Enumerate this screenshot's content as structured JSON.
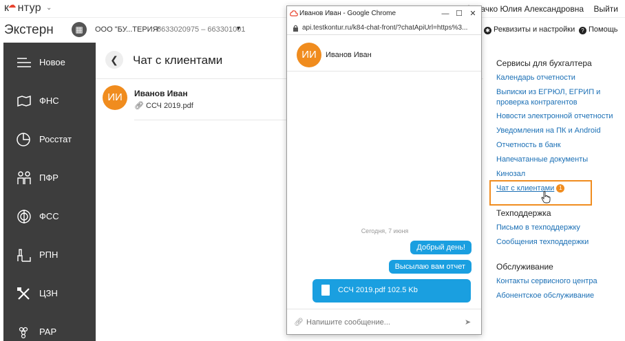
{
  "topbar": {
    "logo": "кнтур",
    "user_name": "Сачко Юлия Александровна",
    "logout": "Выйти"
  },
  "header": {
    "product": "Экстерн",
    "org_name": "ООО \"БУ...ТЕРИЯ\"",
    "org_inn": "6633020975 – 663301001",
    "settings": "Реквизиты и настройки",
    "help": "Помощь"
  },
  "sidebar": {
    "items": [
      {
        "label": "Новое",
        "icon": "list-icon"
      },
      {
        "label": "ФНС",
        "icon": "map-icon"
      },
      {
        "label": "Росстат",
        "icon": "pie-chart-icon"
      },
      {
        "label": "ПФР",
        "icon": "people-icon"
      },
      {
        "label": "ФСС",
        "icon": "fss-icon"
      },
      {
        "label": "РПН",
        "icon": "factory-icon"
      },
      {
        "label": "ЦЗН",
        "icon": "tools-icon"
      },
      {
        "label": "РАР",
        "icon": "grapes-icon"
      }
    ]
  },
  "main": {
    "title": "Чат с клиентами",
    "chats": [
      {
        "initials": "ИИ",
        "name": "Иванов Иван",
        "file": "ССЧ 2019.pdf"
      }
    ]
  },
  "right_panel": {
    "accounting_title": "Сервисы для бухгалтера",
    "accounting_links": [
      "Календарь отчетности",
      "Выписки из ЕГРЮЛ, ЕГРИП и проверка контрагентов",
      "Новости электронной отчетности",
      "Уведомления на ПК и Android",
      "Отчетность в банк",
      "Напечатанные документы",
      "Кинозал",
      "Чат с клиентами"
    ],
    "chat_badge": "1",
    "support_title": "Техподдержка",
    "support_links": [
      "Письмо в техподдержку",
      "Сообщения техподдержки"
    ],
    "service_title": "Обслуживание",
    "service_links": [
      "Контакты сервисного центра",
      "Абонентское обслуживание"
    ]
  },
  "popup": {
    "window_title": "Иванов Иван - Google Chrome",
    "url": "api.testkontur.ru/k84-chat-front/?chatApiUrl=https%3...",
    "contact_initials": "ИИ",
    "contact_name": "Иванов Иван",
    "date_separator": "Сегодня, 7 июня",
    "messages": [
      "Добрый день!",
      "Высылаю вам отчет"
    ],
    "file_message": "ССЧ 2019.pdf 102.5 Kb",
    "composer_placeholder": "Напишите сообщение..."
  },
  "colors": {
    "accent_orange": "#f08c1e",
    "link_blue": "#1a6fb5",
    "bubble_blue": "#1a9fe0",
    "sidebar_dark": "#3d3d3d"
  }
}
